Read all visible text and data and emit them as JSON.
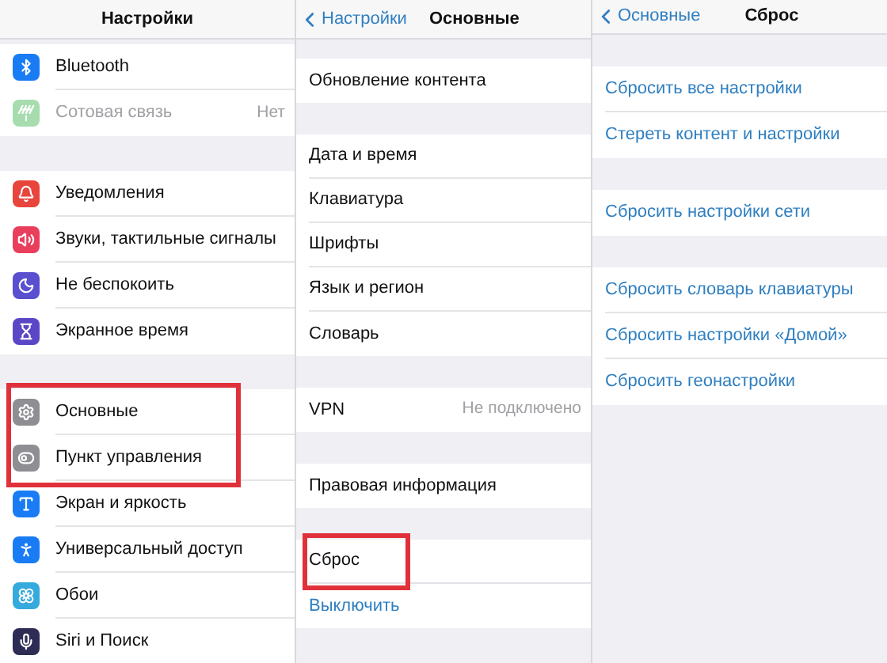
{
  "panels": [
    {
      "title": "Настройки",
      "sections": [
        {
          "rows": [
            {
              "label": "Bluetooth",
              "color": "#1a7cf5",
              "disabled": false,
              "highlighted": false,
              "kind": "plain"
            },
            {
              "label": "Сотовая связь",
              "color": "#a6dcae",
              "disabled": true,
              "value": "Нет",
              "highlighted": false,
              "kind": "plain"
            }
          ]
        },
        {
          "rows": [
            {
              "label": "Уведомления",
              "color": "#e8453c",
              "disabled": false,
              "highlighted": false,
              "kind": "plain"
            },
            {
              "label": "Звуки, тактильные сигналы",
              "color": "#ea3e5d",
              "disabled": false,
              "highlighted": false,
              "kind": "plain"
            },
            {
              "label": "Не беспокоить",
              "color": "#5a4fcf",
              "disabled": false,
              "highlighted": false,
              "kind": "plain"
            },
            {
              "label": "Экранное время",
              "color": "#5b47c6",
              "disabled": false,
              "highlighted": false,
              "kind": "plain"
            }
          ]
        },
        {
          "rows": [
            {
              "label": "Основные",
              "color": "#8e8e93",
              "disabled": false,
              "highlighted": true,
              "kind": "plain"
            },
            {
              "label": "Пункт управления",
              "color": "#8e8e93",
              "disabled": false,
              "highlighted": true,
              "kind": "plain"
            },
            {
              "label": "Экран и яркость",
              "color": "#1a7cf5",
              "disabled": false,
              "highlighted": false,
              "kind": "plain"
            },
            {
              "label": "Универсальный доступ",
              "color": "#1a7cf5",
              "disabled": false,
              "highlighted": false,
              "kind": "plain"
            },
            {
              "label": "Обои",
              "color": "#35aadc",
              "disabled": false,
              "highlighted": false,
              "kind": "plain"
            },
            {
              "label": "Siri и Поиск",
              "color": "#2c2c54",
              "disabled": false,
              "highlighted": false,
              "kind": "plain"
            }
          ]
        }
      ]
    },
    {
      "back": "Настройки",
      "title": "Основные",
      "sections": [
        {
          "rows": [
            {
              "label": "Обновление контента",
              "highlighted": false,
              "kind": "plain"
            }
          ]
        },
        {
          "rows": [
            {
              "label": "Дата и время",
              "highlighted": false,
              "kind": "plain"
            },
            {
              "label": "Клавиатура",
              "highlighted": false,
              "kind": "plain"
            },
            {
              "label": "Шрифты",
              "highlighted": false,
              "kind": "plain"
            },
            {
              "label": "Язык и регион",
              "highlighted": false,
              "kind": "plain"
            },
            {
              "label": "Словарь",
              "highlighted": false,
              "kind": "plain"
            }
          ]
        },
        {
          "rows": [
            {
              "label": "VPN",
              "value": "Не подключено",
              "highlighted": false,
              "kind": "plain"
            }
          ]
        },
        {
          "rows": [
            {
              "label": "Правовая информация",
              "highlighted": false,
              "kind": "plain"
            }
          ]
        },
        {
          "rows": [
            {
              "label": "Сброс",
              "highlighted": true,
              "kind": "plain"
            },
            {
              "label": "Выключить",
              "highlighted": false,
              "kind": "action"
            }
          ]
        }
      ]
    },
    {
      "back": "Основные",
      "title": "Сброс",
      "sections": [
        {
          "rows": [
            {
              "label": "Сбросить все настройки",
              "highlighted": false,
              "kind": "action"
            },
            {
              "label": "Стереть контент и настройки",
              "highlighted": false,
              "kind": "action"
            }
          ]
        },
        {
          "rows": [
            {
              "label": "Сбросить настройки сети",
              "highlighted": false,
              "kind": "action"
            }
          ]
        },
        {
          "rows": [
            {
              "label": "Сбросить словарь клавиатуры",
              "highlighted": false,
              "kind": "action"
            },
            {
              "label": "Сбросить настройки «Домой»",
              "highlighted": false,
              "kind": "action"
            },
            {
              "label": "Сбросить геонастройки",
              "highlighted": false,
              "kind": "action"
            }
          ]
        }
      ]
    }
  ]
}
